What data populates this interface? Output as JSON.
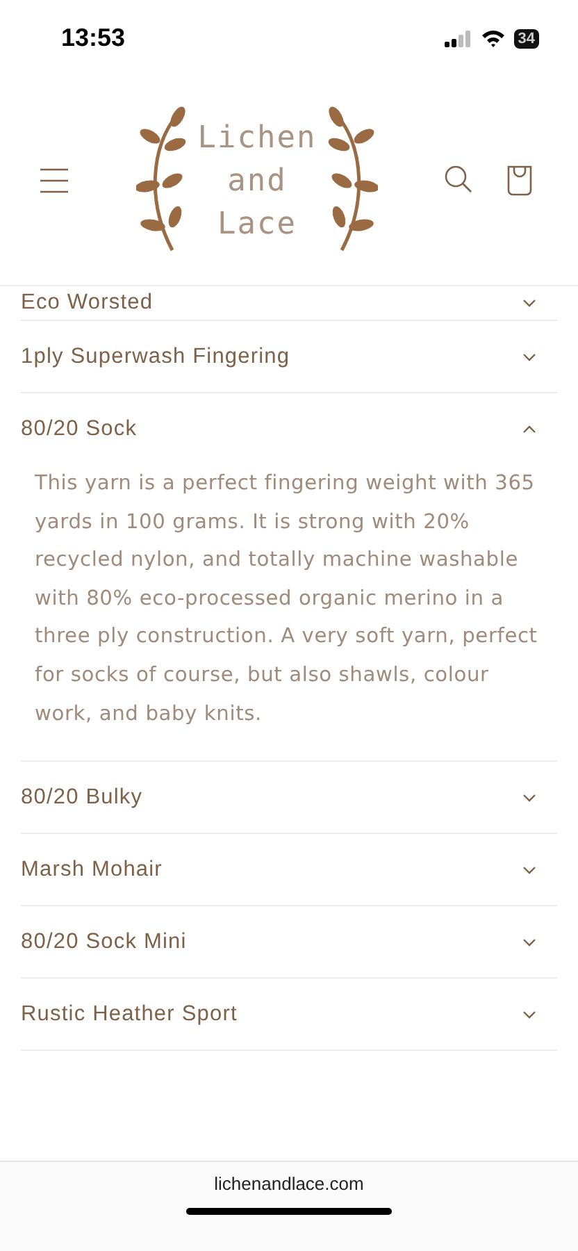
{
  "status_bar": {
    "time": "13:53",
    "battery": "34"
  },
  "header": {
    "logo_lines": [
      "Lichen",
      "and",
      "Lace"
    ]
  },
  "accordion": [
    {
      "title": "Eco Worsted",
      "expanded": false
    },
    {
      "title": "1ply Superwash Fingering",
      "expanded": false
    },
    {
      "title": "80/20 Sock",
      "expanded": true,
      "body": "This yarn is a perfect fingering weight with 365 yards in 100 grams. It is strong with 20% recycled nylon, and totally machine washable with 80% eco-processed organic merino in a three ply construction.  A very soft yarn, perfect for socks of course, but also shawls, colour work, and baby knits."
    },
    {
      "title": "80/20 Bulky",
      "expanded": false
    },
    {
      "title": "Marsh Mohair",
      "expanded": false
    },
    {
      "title": "80/20 Sock Mini",
      "expanded": false
    },
    {
      "title": "Rustic Heather Sport",
      "expanded": false
    }
  ],
  "browser_bar": {
    "url": "lichenandlace.com"
  }
}
